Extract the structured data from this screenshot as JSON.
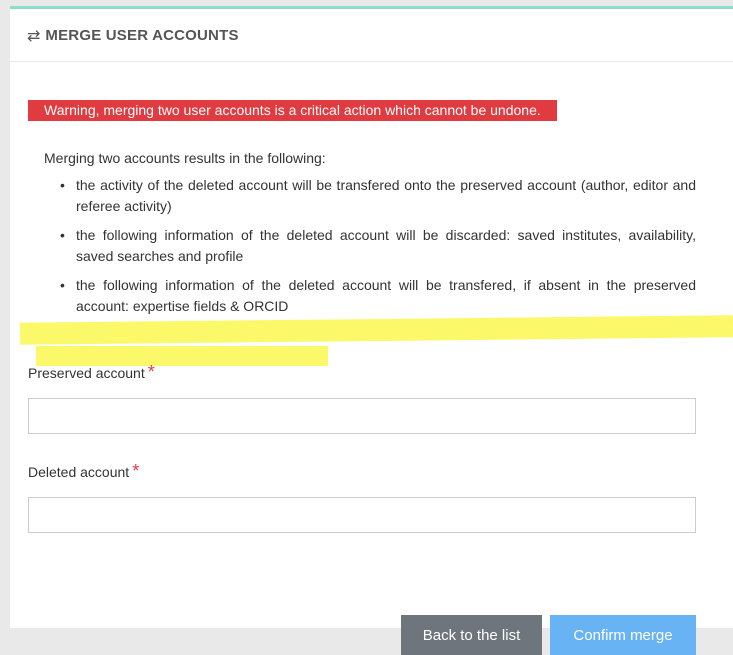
{
  "header": {
    "icon": "swap-arrows-icon",
    "title": "MERGE USER ACCOUNTS"
  },
  "warning": "Warning, merging two user accounts is a critical action which cannot be undone.",
  "intro": "Merging two accounts results in the following:",
  "bullets": [
    "the activity of the deleted account will be transfered onto the preserved account (author, editor and referee activity)",
    "the following information of the deleted account will be discarded: saved institutes, availability, saved searches and profile",
    "the following information of the deleted account will be transfered, if absent in the preserved account: expertise fields & ORCID"
  ],
  "form": {
    "preserved_label": "Preserved account",
    "preserved_value": "",
    "deleted_label": "Deleted account",
    "deleted_value": "",
    "required_mark": "*"
  },
  "buttons": {
    "back": "Back to the list",
    "confirm": "Confirm merge"
  },
  "colors": {
    "accent_top": "#8fdcc8",
    "warning": "#e03b41",
    "highlight": "#fbf75a",
    "confirm": "#68b3f4",
    "back": "#6e757c"
  }
}
